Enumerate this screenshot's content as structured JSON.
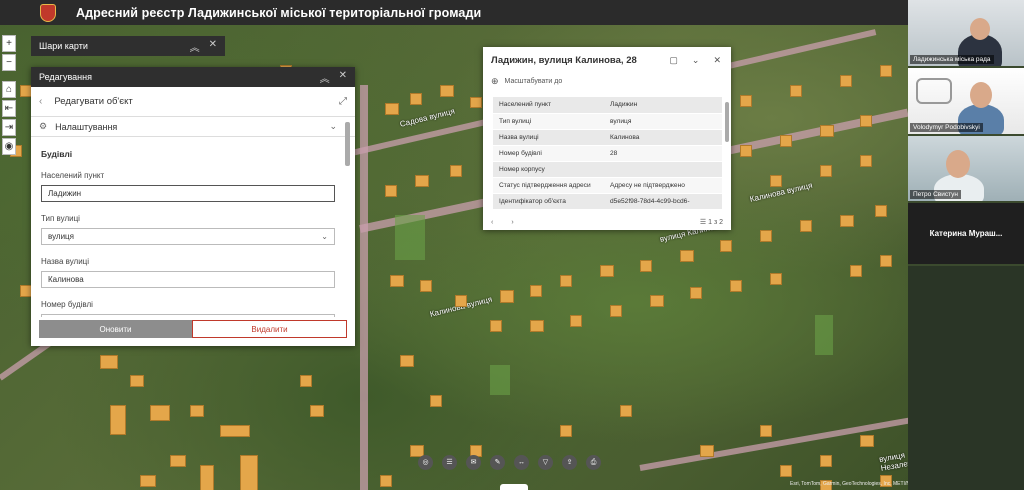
{
  "header": {
    "title": "Адресний реєстр Ладижинської міської територіальної громади"
  },
  "map_tools": [
    "+",
    "−",
    "⌂",
    "⇤",
    "⇥",
    "◉"
  ],
  "layers_panel": {
    "title": "Шари карти"
  },
  "edit_panel": {
    "title": "Редагування",
    "subtitle": "Редагувати об'єкт",
    "settings": "Налаштування",
    "section": "Будівлі",
    "fields": [
      {
        "label": "Населений пункт",
        "value": "Ладижин"
      },
      {
        "label": "Тип вулиці",
        "value": "вулиця"
      },
      {
        "label": "Назва вулиці",
        "value": "Калинова"
      },
      {
        "label": "Номер будівлі",
        "value": "28"
      }
    ],
    "update_button": "Оновити",
    "delete_button": "Видалити"
  },
  "popup": {
    "title": "Ладижин, вулиця Калинова, 28",
    "zoom_label": "Масштабувати до",
    "rows": [
      {
        "key": "Населений пункт",
        "value": "Ладижин"
      },
      {
        "key": "Тип вулиці",
        "value": "вулиця"
      },
      {
        "key": "Назва вулиці",
        "value": "Калинова"
      },
      {
        "key": "Номер будівлі",
        "value": "28"
      },
      {
        "key": "Номер корпусу",
        "value": ""
      },
      {
        "key": "Статус підтвердження адреси",
        "value": "Адресу не підтверджено"
      },
      {
        "key": "Ідентифікатор об'єкта",
        "value": "d5e52f98-78d4-4c99-bcd6-"
      }
    ],
    "pager": "1 з 2"
  },
  "map_labels": {
    "street_1": "Калинова вулиця",
    "street_2": "Калинова вулиця",
    "street_3": "вулиця Калинова",
    "street_4": "Садова вулиця",
    "street_5": "вулиця Незалежності"
  },
  "attribution": "Esri, TomTom, Garmin, GeoTechnologies, Inc, METI/NASA, USGS",
  "video_tiles": [
    {
      "name": "Ладижинська міська рада"
    },
    {
      "name": "Volodymyr Podobivskyi"
    },
    {
      "name": "Петро Свистун"
    },
    {
      "name": "Катерина  Мураш..."
    }
  ],
  "colors": {
    "header_bg": "#2b2b2b",
    "building": "#e4a64a",
    "road": "#c99fae",
    "delete": "#c0392b"
  }
}
